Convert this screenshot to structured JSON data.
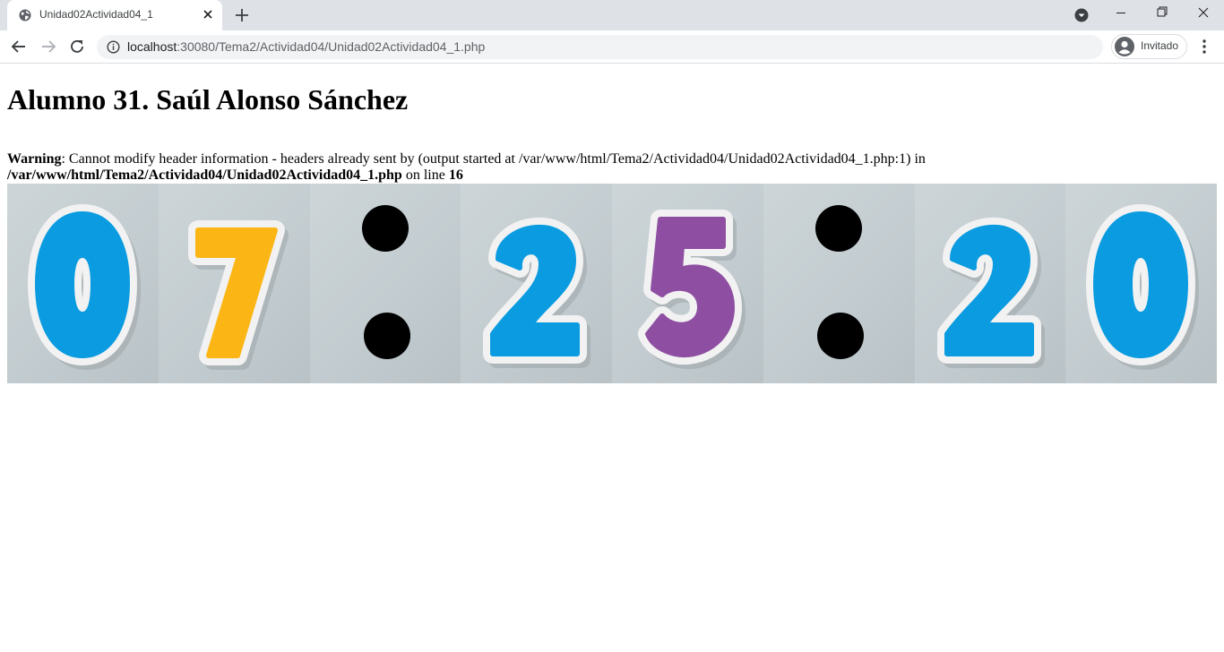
{
  "browser": {
    "tab_title": "Unidad02Actividad04_1",
    "url_host": "localhost",
    "url_rest": ":30080/Tema2/Actividad04/Unidad02Actividad04_1.php",
    "profile_label": "Invitado"
  },
  "page": {
    "heading": "Alumno 31. Saúl Alonso Sánchez",
    "warning": {
      "label": "Warning",
      "message": ": Cannot modify header information - headers already sent by (output started at /var/www/html/Tema2/Actividad04/Unidad02Actividad04_1.php:1) in ",
      "path": "/var/www/html/Tema2/Actividad04/Unidad02Actividad04_1.php",
      "line_text": " on line ",
      "line_number": "16"
    }
  },
  "clock": {
    "time": "07:25:20",
    "colors": {
      "blue": "#0a9be0",
      "yellow": "#fbb616",
      "purple": "#8e4fa2",
      "dot": "#000000"
    }
  }
}
